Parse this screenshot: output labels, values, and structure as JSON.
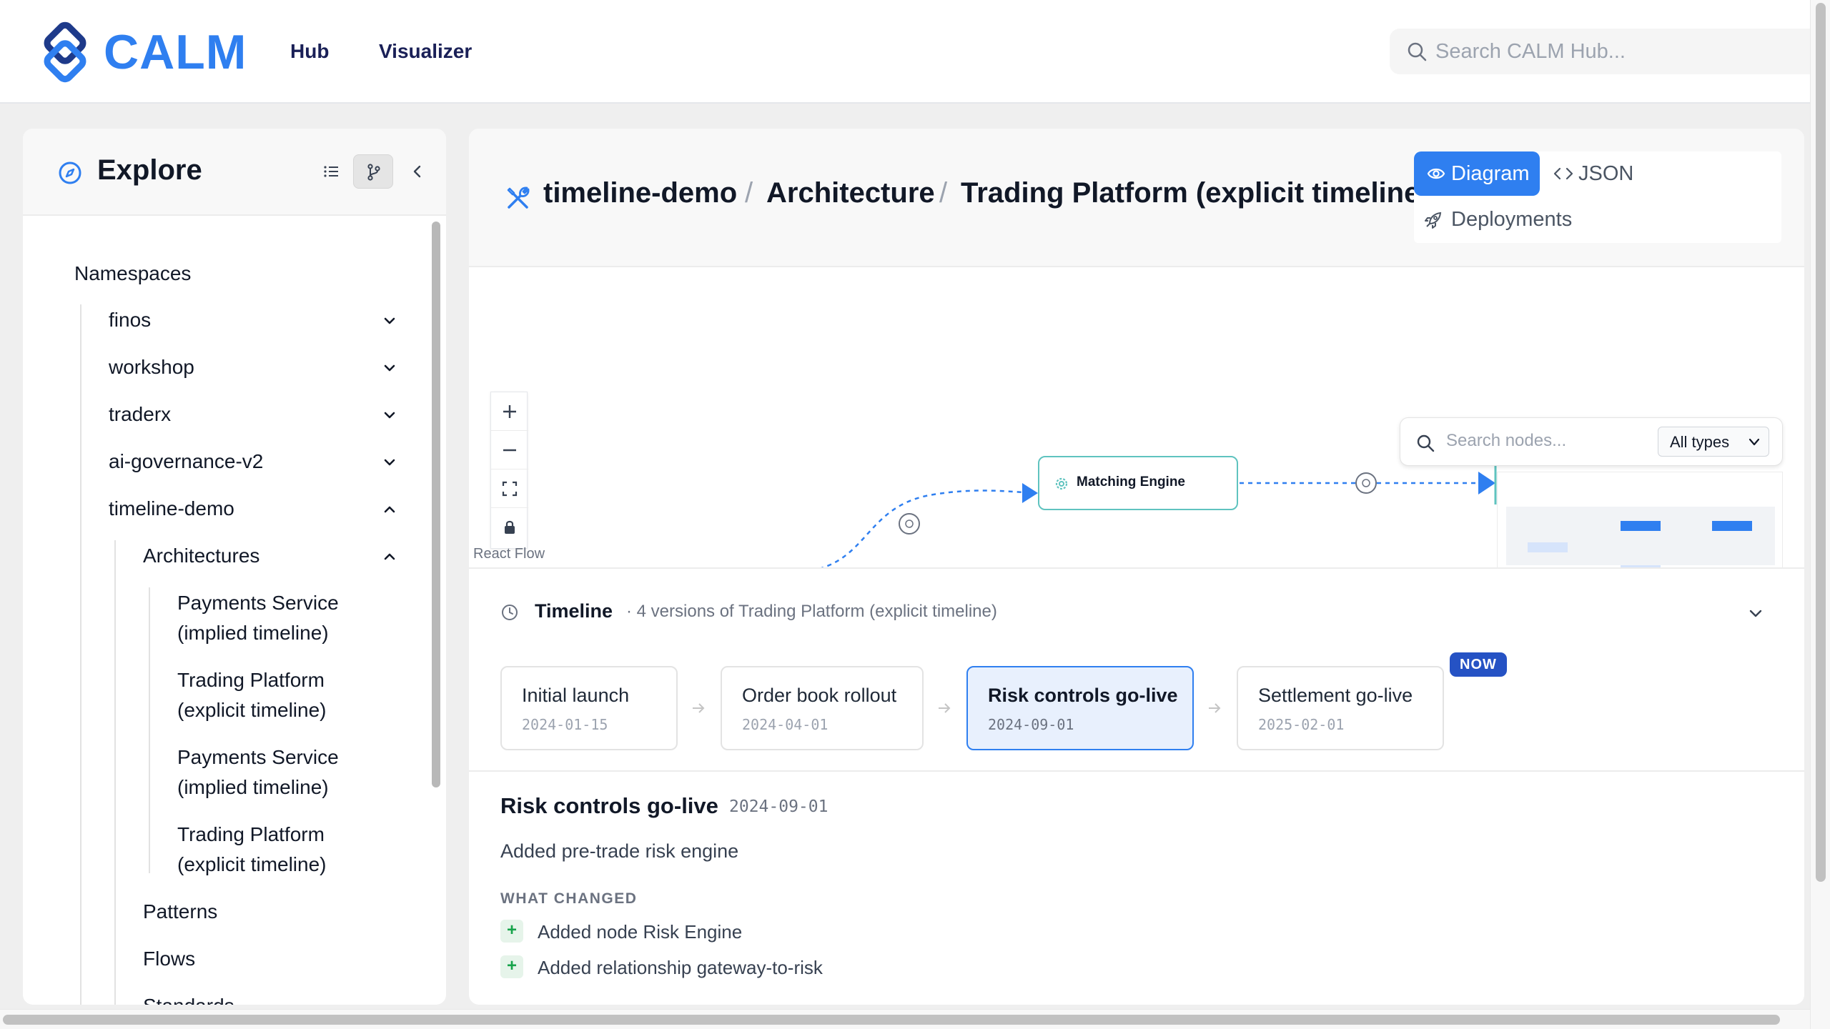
{
  "brand": {
    "name": "CALM",
    "color": "#2f7ff0"
  },
  "nav": {
    "hub": "Hub",
    "visualizer": "Visualizer"
  },
  "top_search": {
    "placeholder": "Search CALM Hub...",
    "icon": "search-icon"
  },
  "sidebar": {
    "title": "Explore",
    "namespaces_label": "Namespaces",
    "namespaces": [
      "finos",
      "workshop",
      "traderx",
      "ai-governance-v2",
      "timeline-demo"
    ],
    "architectures_label": "Architectures",
    "architectures": [
      {
        "line1": "Payments Service",
        "line2": "(implied timeline)"
      },
      {
        "line1": "Trading Platform",
        "line2": "(explicit timeline)"
      },
      {
        "line1": "Payments Service",
        "line2": "(implied timeline)"
      },
      {
        "line1": "Trading Platform",
        "line2": "(explicit timeline)"
      }
    ],
    "patterns_label": "Patterns",
    "flows_label": "Flows",
    "standards_label": "Standards"
  },
  "breadcrumb": {
    "namespace": "timeline-demo",
    "section": "Architecture",
    "item": "Trading Platform (explicit timeline)",
    "separator": "/"
  },
  "view_tabs": {
    "diagram": "Diagram",
    "json": "JSON",
    "deployments": "Deployments",
    "active": "Diagram"
  },
  "canvas": {
    "node_search_placeholder": "Search nodes...",
    "type_filter": "All types",
    "react_flow_label": "React Flow",
    "node_label": "Matching Engine",
    "accent_color": "#2f7ff0",
    "node_border_color": "#5fc3bf"
  },
  "timeline": {
    "title": "Timeline",
    "subtitle": "· 4 versions of Trading Platform (explicit timeline)",
    "now_badge": "NOW",
    "versions": [
      {
        "title": "Initial launch",
        "date": "2024-01-15"
      },
      {
        "title": "Order book rollout",
        "date": "2024-04-01"
      },
      {
        "title": "Risk controls go-live",
        "date": "2024-09-01"
      },
      {
        "title": "Settlement go-live",
        "date": "2025-02-01"
      }
    ],
    "current_index": 2
  },
  "detail": {
    "title": "Risk controls go-live",
    "date": "2024-09-01",
    "description": "Added pre-trade risk engine",
    "changed_label": "WHAT CHANGED",
    "changes": [
      {
        "symbol": "+",
        "text": "Added node Risk Engine"
      },
      {
        "symbol": "+",
        "text": "Added relationship gateway-to-risk"
      }
    ]
  }
}
